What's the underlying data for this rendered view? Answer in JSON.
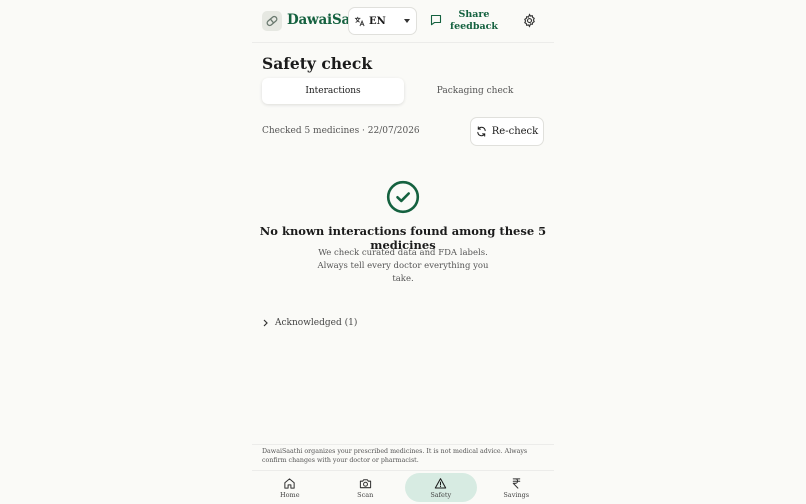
{
  "header": {
    "brand": "DawaiSaathi",
    "language": "EN",
    "feedback_label": "Share feedback"
  },
  "page": {
    "title": "Safety check",
    "tabs": [
      {
        "label": "Interactions",
        "active": true
      },
      {
        "label": "Packaging check",
        "active": false
      }
    ],
    "checked_text": "Checked 5 medicines · 22/07/2026",
    "recheck_label": "Re-check",
    "result_headline": "No known interactions found among these 5 medicines",
    "result_subtext": "We check curated data and FDA labels. Always tell every doctor everything you take.",
    "acknowledged_label": "Acknowledged (1)"
  },
  "footer": {
    "disclaimer": "DawaiSaathi organizes your prescribed medicines. It is not medical advice. Always confirm changes with your doctor or pharmacist."
  },
  "bottom_nav": [
    {
      "label": "Home",
      "icon": "home-icon",
      "active": false
    },
    {
      "label": "Scan",
      "icon": "camera-icon",
      "active": false
    },
    {
      "label": "Safety",
      "icon": "warning-triangle-icon",
      "active": true
    },
    {
      "label": "Savings",
      "icon": "rupee-icon",
      "active": false
    }
  ],
  "colors": {
    "brand_green": "#14613f",
    "active_tab_bg": "#d7ebe2",
    "background": "#fafaf7"
  }
}
